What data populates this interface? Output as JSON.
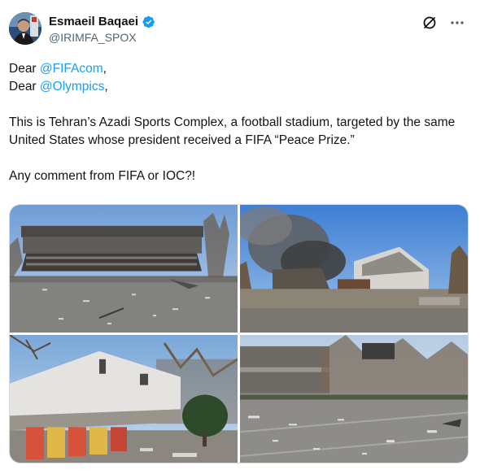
{
  "author": {
    "name": "Esmaeil Baqaei",
    "handle": "@IRIMFA_SPOX",
    "verified_color": "#1d9bf0"
  },
  "icons": {
    "grok": "grok-icon",
    "more": "more-icon",
    "verified": "verified-badge-icon"
  },
  "tweet": {
    "line1_prefix": "Dear ",
    "line1_mention": "@FIFAcom",
    "line1_suffix": ",",
    "line2_prefix": "Dear ",
    "line2_mention": "@Olympics",
    "line2_suffix": ",",
    "paragraph": "This is Tehran’s Azadi Sports Complex, a football stadium, targeted by the same United States whose president received a FIFA “Peace Prize.”",
    "question": "Any comment from FIFA or IOC?!"
  },
  "media": {
    "photos": [
      "stadium-damaged-grandstand",
      "stadium-smoke-burning",
      "stadium-building-damaged",
      "stadium-plaza-debris"
    ]
  },
  "colors": {
    "link": "#1d9bf0",
    "text": "#0f1419",
    "muted": "#536471"
  }
}
